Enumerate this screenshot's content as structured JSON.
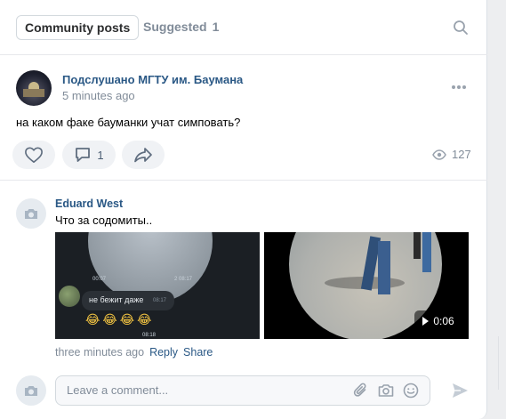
{
  "tabs": {
    "active_label": "Community posts",
    "inactive_label": "Suggested",
    "suggested_count": "1"
  },
  "post": {
    "author": "Подслушано МГТУ им. Баумана",
    "time": "5 minutes ago",
    "text": "на каком факе бауманки учат симповать?",
    "comments_count": "1",
    "views": "127"
  },
  "comment": {
    "author": "Eduard West",
    "text": "Что за содомиты..",
    "media1": {
      "time_left": "00:07",
      "time_right": "2 08:17",
      "bubble_text": "не бежит даже",
      "bubble_time": "08:17",
      "emojis": "😂😂😂😂",
      "bottom_time": "08:18"
    },
    "video_duration": "0:06",
    "time": "three minutes ago",
    "reply_label": "Reply",
    "share_label": "Share"
  },
  "composer": {
    "placeholder": "Leave a comment..."
  },
  "colors": {
    "link": "#2a5885",
    "muted": "#818c99",
    "accent": "#5181b8"
  }
}
